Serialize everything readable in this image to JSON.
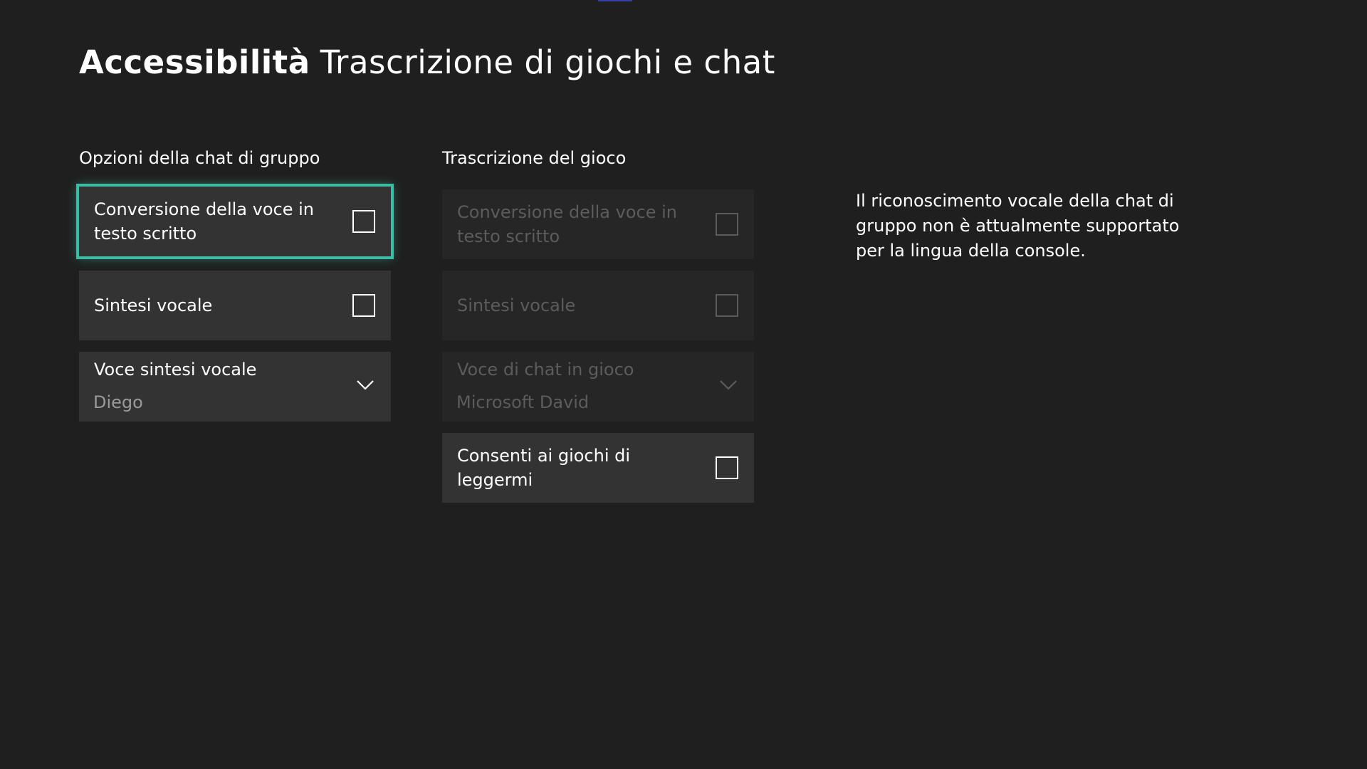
{
  "header": {
    "section": "Accessibilità",
    "subtitle": "Trascrizione di giochi e chat"
  },
  "group_chat": {
    "header": "Opzioni della chat di gruppo",
    "speech_to_text": {
      "label": "Conversione della voce in testo scritto",
      "checked": false,
      "focused": true
    },
    "text_to_speech": {
      "label": "Sintesi vocale",
      "checked": false
    },
    "tts_voice": {
      "label": "Voce sintesi vocale",
      "value": "Diego"
    }
  },
  "game_transcription": {
    "header": "Trascrizione del gioco",
    "speech_to_text": {
      "label": "Conversione della voce in testo scritto",
      "checked": false,
      "disabled": true
    },
    "text_to_speech": {
      "label": "Sintesi vocale",
      "checked": false,
      "disabled": true
    },
    "chat_voice": {
      "label": "Voce di chat in gioco",
      "value": "Microsoft David",
      "disabled": true
    },
    "allow_games_read": {
      "label": "Consenti ai giochi di leggermi",
      "checked": false
    }
  },
  "info": {
    "text": "Il riconoscimento vocale della chat di gruppo non è attualmente supportato per la lingua della console."
  },
  "colors": {
    "background": "#1f1f1f",
    "tile": "#333333",
    "tile_disabled": "#262626",
    "focus": "#3cbca5",
    "disabled_text": "#5c5c5c",
    "secondary_text": "#9a9a9a"
  },
  "icons": {
    "dropdown": "chevron-down-icon",
    "checkbox": "checkbox-unchecked-icon"
  }
}
